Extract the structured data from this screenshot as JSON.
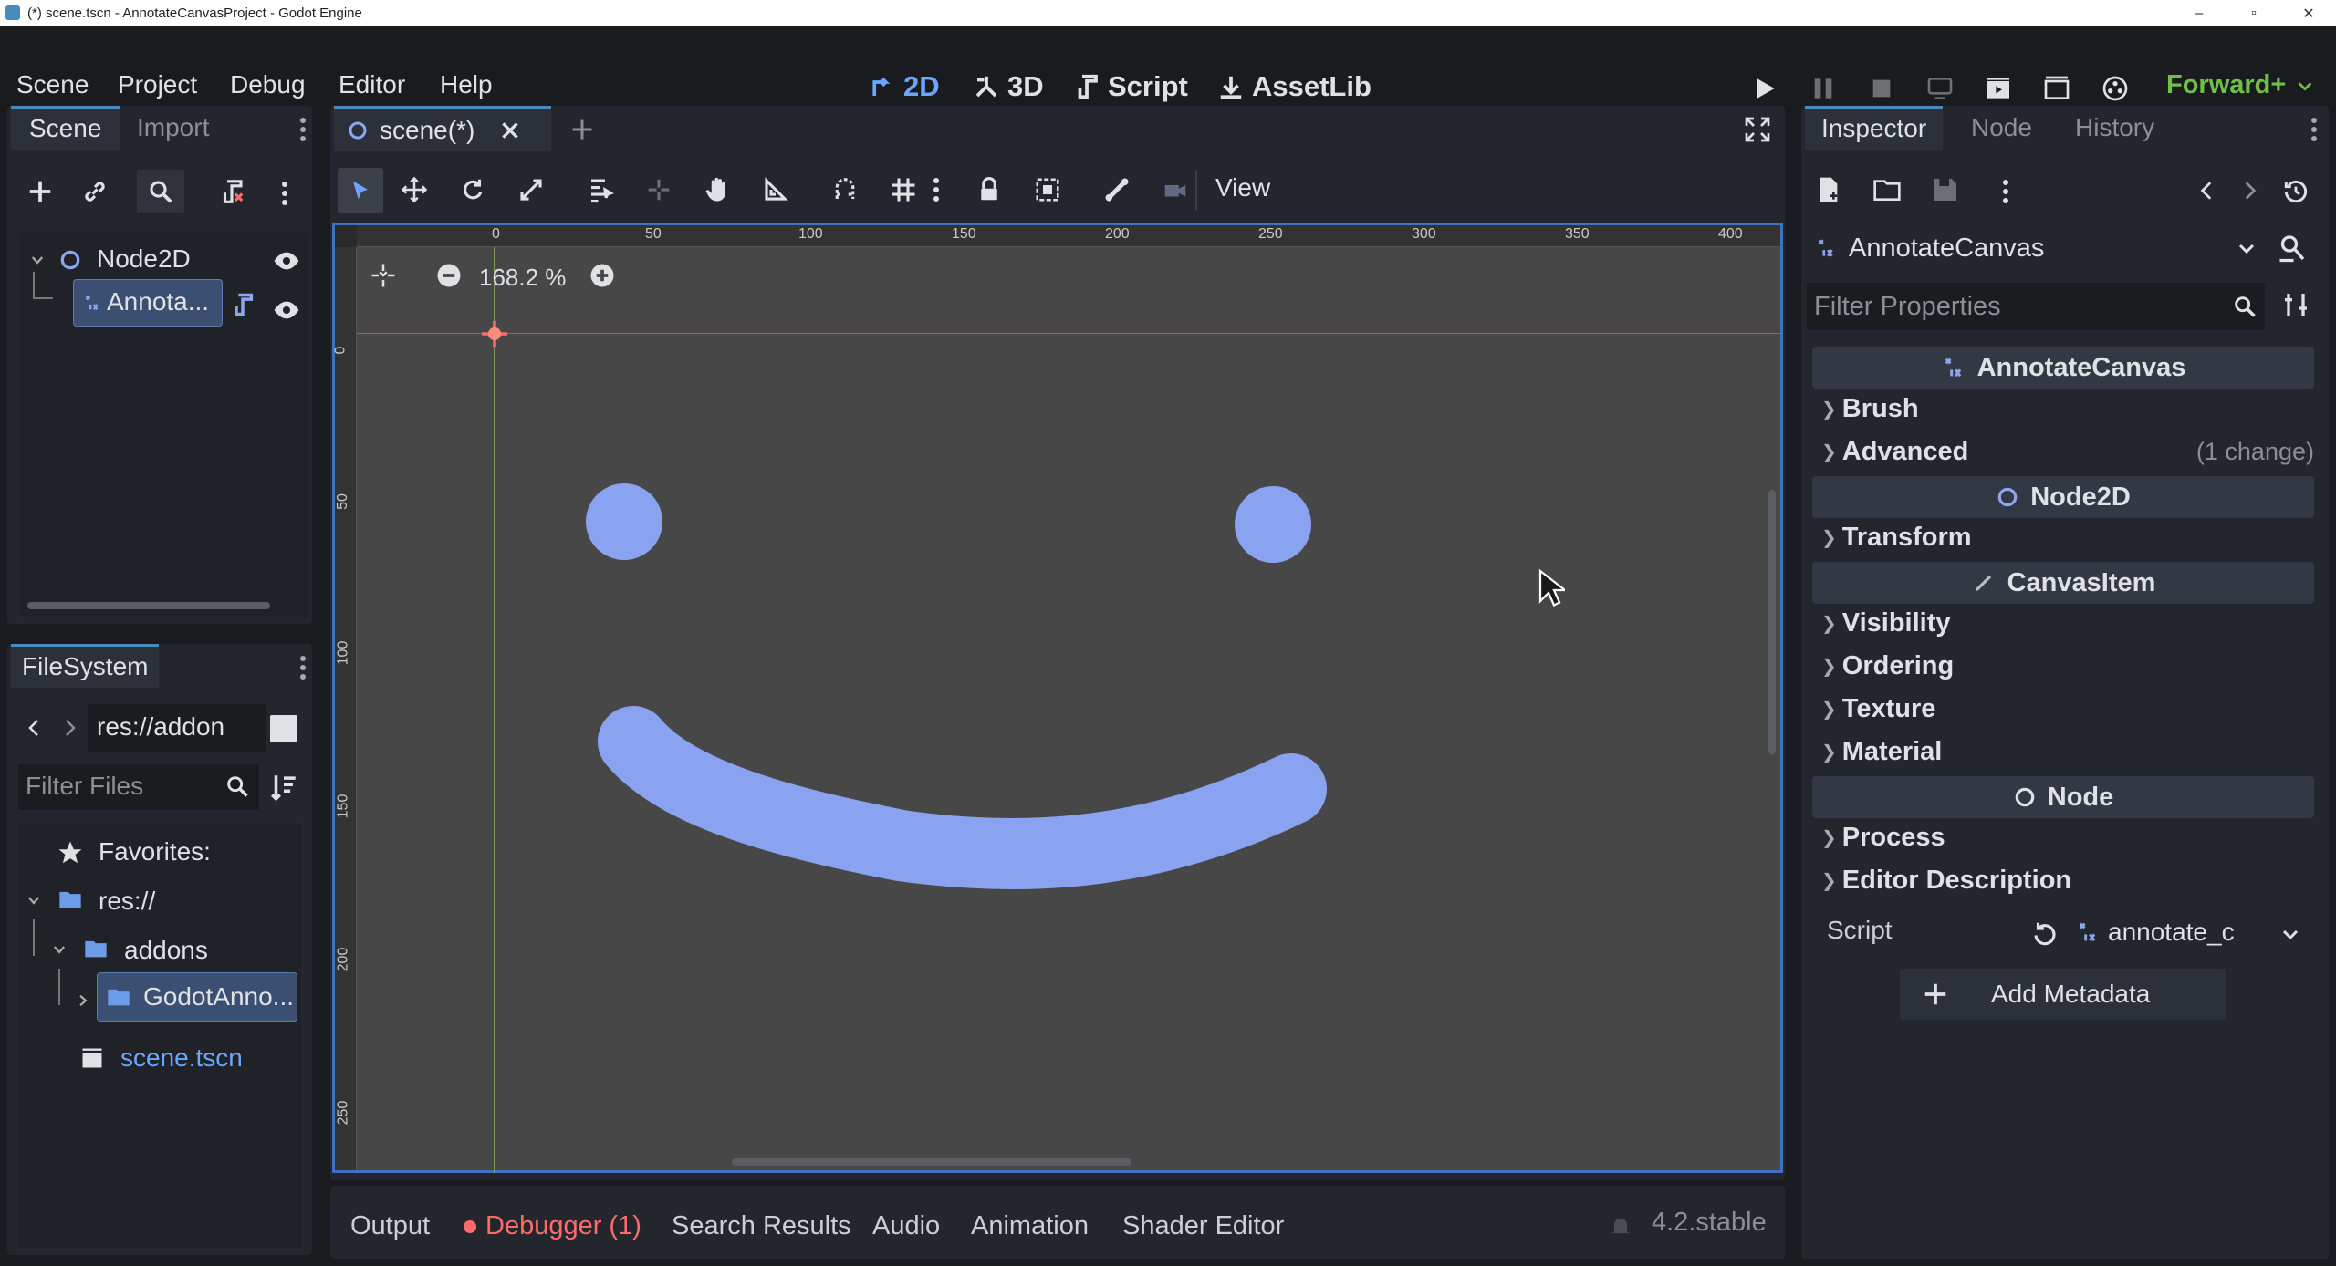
{
  "window": {
    "title": "(*) scene.tscn - AnnotateCanvasProject - Godot Engine",
    "min": "–",
    "max": "▫",
    "close": "✕"
  },
  "menu": [
    "Scene",
    "Project",
    "Debug",
    "Editor",
    "Help"
  ],
  "workspaces": [
    {
      "label": "2D",
      "active": true
    },
    {
      "label": "3D",
      "active": false
    },
    {
      "label": "Script",
      "active": false
    },
    {
      "label": "AssetLib",
      "active": false
    }
  ],
  "renderer": "Forward+",
  "scene_dock": {
    "tabs": [
      "Scene",
      "Import"
    ],
    "nodes": [
      {
        "label": "Node2D"
      },
      {
        "label": "Annota..."
      }
    ]
  },
  "filesystem": {
    "tab": "FileSystem",
    "path": "res://addon",
    "filter_placeholder": "Filter Files",
    "items": [
      {
        "label": "Favorites:"
      },
      {
        "label": "res://"
      },
      {
        "label": "addons"
      },
      {
        "label": "GodotAnno..."
      },
      {
        "label": "scene.tscn"
      }
    ]
  },
  "editor": {
    "scene_tab": "scene(*)",
    "view_label": "View",
    "zoom": "168.2 %",
    "ruler_h": [
      "0",
      "50",
      "100",
      "150",
      "200",
      "250",
      "300",
      "350",
      "400"
    ],
    "ruler_v": [
      "0",
      "50",
      "100",
      "150",
      "200",
      "250"
    ]
  },
  "inspector": {
    "tabs": [
      "Inspector",
      "Node",
      "History"
    ],
    "object": "AnnotateCanvas",
    "filter_placeholder": "Filter Properties",
    "sections": [
      {
        "kind": "header",
        "label": "AnnotateCanvas"
      },
      {
        "kind": "group",
        "label": "Brush"
      },
      {
        "kind": "group",
        "label": "Advanced",
        "note": "(1 change)"
      },
      {
        "kind": "header",
        "label": "Node2D"
      },
      {
        "kind": "group",
        "label": "Transform"
      },
      {
        "kind": "header",
        "label": "CanvasItem"
      },
      {
        "kind": "group",
        "label": "Visibility"
      },
      {
        "kind": "group",
        "label": "Ordering"
      },
      {
        "kind": "group",
        "label": "Texture"
      },
      {
        "kind": "group",
        "label": "Material"
      },
      {
        "kind": "header",
        "label": "Node"
      },
      {
        "kind": "group",
        "label": "Process"
      },
      {
        "kind": "group",
        "label": "Editor Description"
      }
    ],
    "script_label": "Script",
    "script_value": "annotate_c",
    "add_metadata": "Add Metadata"
  },
  "bottom_tabs": [
    "Output",
    "Debugger (1)",
    "Search Results",
    "Audio",
    "Animation",
    "Shader Editor"
  ],
  "version": "4.2.stable",
  "colors": {
    "accent": "#478cbf",
    "drawing": "#8aa3f0",
    "debugger": "#ff6b6b",
    "renderer": "#6fbf4a"
  }
}
